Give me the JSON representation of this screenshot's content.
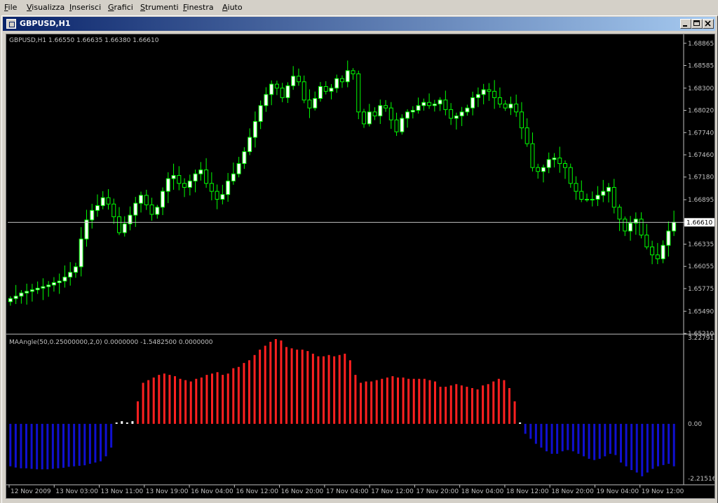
{
  "menu": [
    "File",
    "Visualizza",
    "Inserisci",
    "Grafici",
    "Strumenti",
    "Finestra",
    "Aiuto"
  ],
  "window": {
    "title": "GBPUSD,H1"
  },
  "price_panel": {
    "header": "GBPUSD,H1  1.66550 1.66635 1.66380 1.66610",
    "y_ticks": [
      "1.68865",
      "1.68585",
      "1.68300",
      "1.68020",
      "1.67740",
      "1.67460",
      "1.67180",
      "1.66895",
      "1.66610",
      "1.66335",
      "1.66055",
      "1.65775",
      "1.65490",
      "1.65210"
    ],
    "current_price": "1.66610",
    "colors": {
      "candle_up": "#ffffff",
      "candle_down": "#000000",
      "wick": "#00ff00",
      "price_line": "#c0c0c0"
    }
  },
  "indicator_panel": {
    "header": "MAAngle(50,0.25000000,2,0) 0.0000000 -1.5482500 0.0000000",
    "y_ticks": [
      "3.227912",
      "0.00",
      "-2.21516"
    ],
    "colors": {
      "positive": "#ff2020",
      "negative": "#1010d0",
      "flat": "#ffffff"
    }
  },
  "time_axis": [
    "12 Nov 2009",
    "13 Nov 03:00",
    "13 Nov 11:00",
    "13 Nov 19:00",
    "16 Nov 04:00",
    "16 Nov 12:00",
    "16 Nov 20:00",
    "17 Nov 04:00",
    "17 Nov 12:00",
    "17 Nov 20:00",
    "18 Nov 04:00",
    "18 Nov 12:00",
    "18 Nov 20:00",
    "19 Nov 04:00",
    "19 Nov 12:00"
  ],
  "chart_data": {
    "type": "candlestick",
    "symbol": "GBPUSD",
    "timeframe": "H1",
    "y_range": [
      1.6521,
      1.6896
    ],
    "closes": [
      1.6565,
      1.6568,
      1.6572,
      1.6574,
      1.6576,
      1.6578,
      1.658,
      1.6582,
      1.6585,
      1.6587,
      1.6592,
      1.6598,
      1.6605,
      1.664,
      1.6664,
      1.6676,
      1.6682,
      1.6692,
      1.6684,
      1.6668,
      1.6648,
      1.6659,
      1.667,
      1.6685,
      1.6695,
      1.6683,
      1.6671,
      1.668,
      1.67,
      1.6716,
      1.672,
      1.671,
      1.6705,
      1.6713,
      1.6722,
      1.6727,
      1.671,
      1.67,
      1.669,
      1.6696,
      1.6713,
      1.6722,
      1.6735,
      1.675,
      1.6768,
      1.6788,
      1.6808,
      1.6822,
      1.6835,
      1.683,
      1.6818,
      1.6833,
      1.6845,
      1.6838,
      1.6815,
      1.6805,
      1.6817,
      1.6832,
      1.6826,
      1.683,
      1.6842,
      1.6838,
      1.6852,
      1.6848,
      1.68,
      1.6785,
      1.68,
      1.6795,
      1.6808,
      1.6805,
      1.679,
      1.6775,
      1.6792,
      1.68,
      1.6802,
      1.6808,
      1.6812,
      1.6808,
      1.681,
      1.6815,
      1.6803,
      1.6792,
      1.6795,
      1.68,
      1.6805,
      1.6818,
      1.6822,
      1.6828,
      1.6826,
      1.6818,
      1.681,
      1.6805,
      1.681,
      1.68,
      1.678,
      1.676,
      1.673,
      1.6725,
      1.673,
      1.674,
      1.6742,
      1.6735,
      1.673,
      1.671,
      1.67,
      1.669,
      1.669,
      1.669,
      1.6695,
      1.67,
      1.6705,
      1.668,
      1.6665,
      1.665,
      1.666,
      1.6665,
      1.6645,
      1.663,
      1.662,
      1.6615,
      1.6632,
      1.665,
      1.6661
    ],
    "indicator_values": [
      -1.7,
      -1.75,
      -1.78,
      -1.78,
      -1.8,
      -1.82,
      -1.82,
      -1.82,
      -1.8,
      -1.78,
      -1.76,
      -1.72,
      -1.7,
      -1.68,
      -1.66,
      -1.6,
      -1.55,
      -1.5,
      -1.3,
      -0.95,
      0.05,
      0.1,
      0.05,
      0.1,
      0.85,
      1.55,
      1.65,
      1.75,
      1.85,
      1.9,
      1.85,
      1.8,
      1.7,
      1.65,
      1.6,
      1.7,
      1.75,
      1.85,
      1.9,
      1.95,
      1.85,
      1.9,
      2.1,
      2.15,
      2.3,
      2.4,
      2.6,
      2.8,
      2.95,
      3.1,
      3.2,
      3.15,
      2.9,
      2.85,
      2.8,
      2.8,
      2.75,
      2.65,
      2.55,
      2.55,
      2.6,
      2.55,
      2.6,
      2.65,
      2.4,
      1.85,
      1.55,
      1.6,
      1.6,
      1.65,
      1.7,
      1.75,
      1.8,
      1.75,
      1.75,
      1.7,
      1.7,
      1.7,
      1.7,
      1.65,
      1.6,
      1.4,
      1.4,
      1.45,
      1.5,
      1.45,
      1.4,
      1.35,
      1.3,
      1.45,
      1.5,
      1.6,
      1.7,
      1.65,
      1.35,
      0.85,
      0.05,
      -0.4,
      -0.6,
      -0.8,
      -0.95,
      -1.1,
      -1.2,
      -1.2,
      -1.1,
      -1.05,
      -1.1,
      -1.2,
      -1.3,
      -1.4,
      -1.45,
      -1.4,
      -1.3,
      -1.2,
      -1.25,
      -1.55,
      -1.7,
      -1.85,
      -1.95,
      -2.1,
      -1.95,
      -1.8,
      -1.7,
      -1.65,
      -1.6,
      -1.7
    ]
  }
}
